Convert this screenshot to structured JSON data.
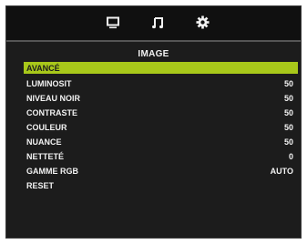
{
  "osd": {
    "tabs": [
      {
        "icon": "monitor-icon",
        "active": false
      },
      {
        "icon": "music-note-icon",
        "active": false
      },
      {
        "icon": "gear-icon",
        "active": true
      }
    ],
    "title": "IMAGE",
    "items": [
      {
        "label": "AVANCÉ",
        "value": "",
        "selected": true
      },
      {
        "label": "LUMINOSIT",
        "value": "50"
      },
      {
        "label": "NIVEAU NOIR",
        "value": "50"
      },
      {
        "label": "CONTRASTE",
        "value": "50"
      },
      {
        "label": "COULEUR",
        "value": "50"
      },
      {
        "label": "NUANCE",
        "value": "50"
      },
      {
        "label": "NETTETÉ",
        "value": "0"
      },
      {
        "label": "GAMME RGB",
        "value": "AUTO"
      },
      {
        "label": "RESET",
        "value": ""
      }
    ]
  },
  "colors": {
    "highlight": "#a8c81a",
    "background": "#1c1c1c",
    "text": "#f2f2f2"
  }
}
